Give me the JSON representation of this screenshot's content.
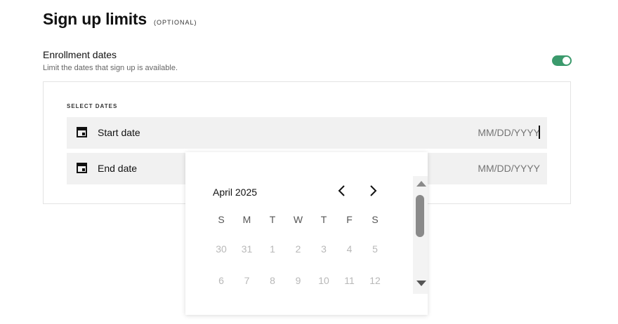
{
  "section": {
    "title": "Sign up limits",
    "optional_tag": "(OPTIONAL)"
  },
  "enrollment": {
    "label": "Enrollment dates",
    "description": "Limit the dates that sign up is available.",
    "toggle_on": true,
    "accent_color": "#3b9a6c"
  },
  "card": {
    "select_dates_label": "SELECT DATES",
    "start_field": {
      "icon": "calendar-icon",
      "label": "Start date",
      "placeholder": "MM/DD/YYYY",
      "value": ""
    },
    "end_field": {
      "icon": "calendar-icon",
      "label": "End date",
      "placeholder": "MM/DD/YYYY",
      "value": ""
    }
  },
  "datepicker": {
    "month_label": "April 2025",
    "prev_icon": "chevron-left-icon",
    "next_icon": "chevron-right-icon",
    "weekdays": [
      "S",
      "M",
      "T",
      "W",
      "T",
      "F",
      "S"
    ],
    "weeks": [
      [
        "30",
        "31",
        "1",
        "2",
        "3",
        "4",
        "5"
      ],
      [
        "6",
        "7",
        "8",
        "9",
        "10",
        "11",
        "12"
      ]
    ]
  }
}
